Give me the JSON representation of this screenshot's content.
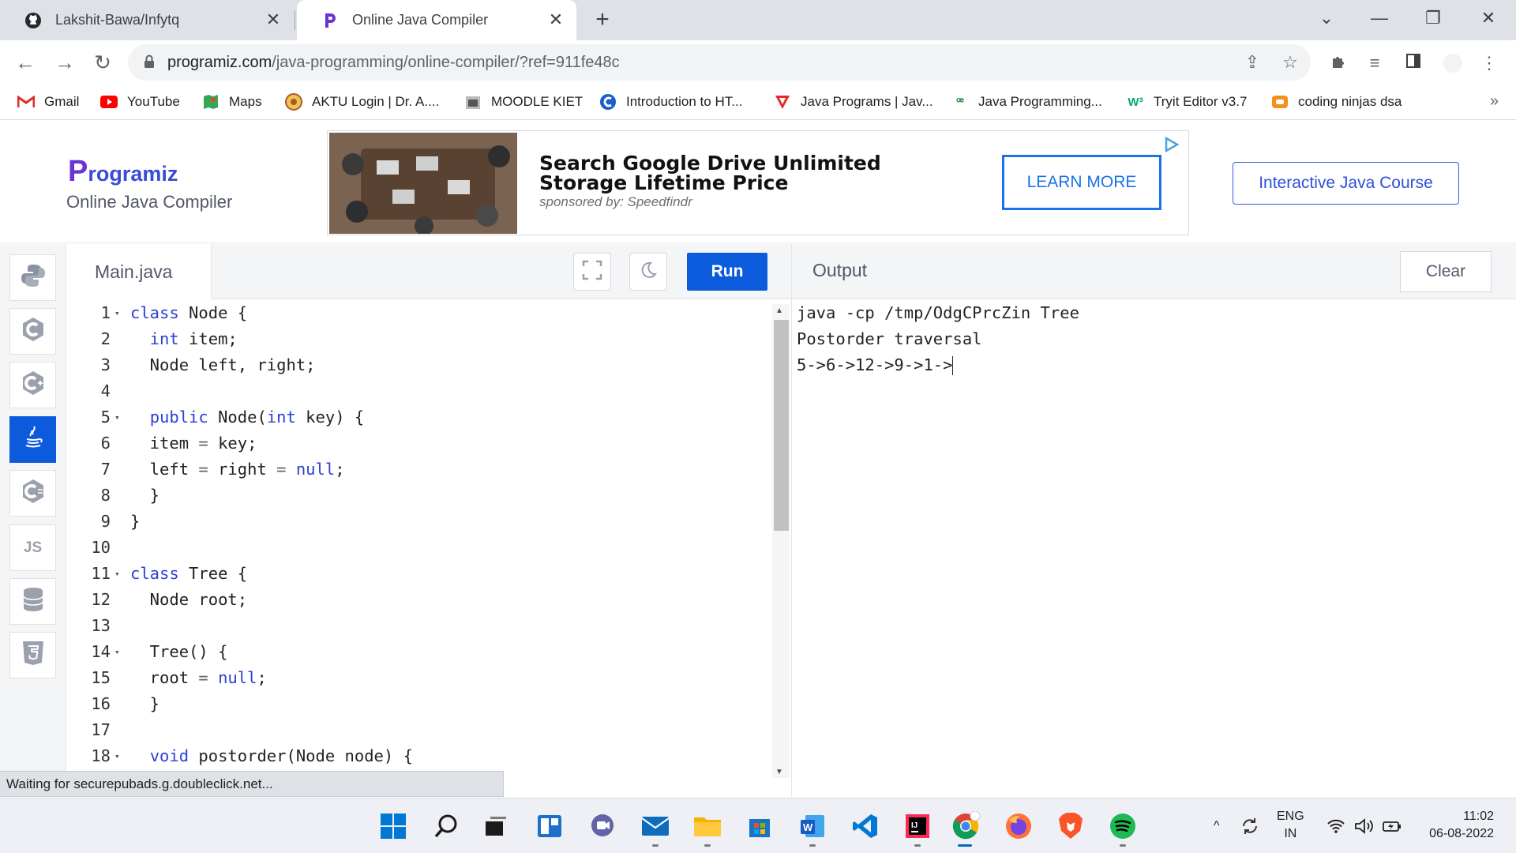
{
  "browser": {
    "tabs": [
      {
        "title": "Lakshit-Bawa/Infytq",
        "icon": "github-icon"
      },
      {
        "title": "Online Java Compiler",
        "icon": "programiz-icon"
      }
    ],
    "url_host": "programiz.com",
    "url_path": "/java-programming/online-compiler/?ref=911fe48c",
    "bookmarks": [
      {
        "label": "Gmail",
        "icon": "gmail-icon"
      },
      {
        "label": "YouTube",
        "icon": "youtube-icon"
      },
      {
        "label": "Maps",
        "icon": "maps-icon"
      },
      {
        "label": "AKTU Login | Dr. A....",
        "icon": "aktu-icon"
      },
      {
        "label": "MOODLE KIET",
        "icon": "moodle-icon"
      },
      {
        "label": "Introduction to HT...",
        "icon": "intro-icon"
      },
      {
        "label": "Java Programs | Jav...",
        "icon": "javatpoint-icon"
      },
      {
        "label": "Java Programming...",
        "icon": "gfg-icon"
      },
      {
        "label": "Tryit Editor v3.7",
        "icon": "w3schools-icon"
      },
      {
        "label": "coding ninjas dsa",
        "icon": "codingninjas-icon"
      }
    ],
    "more_bookmarks": "»"
  },
  "header": {
    "logo_p": "P",
    "logo_rest": "rogramiz",
    "subtitle": "Online Java Compiler",
    "course_button": "Interactive Java Course"
  },
  "ad": {
    "title": "Search Google Drive Unlimited Storage Lifetime Price",
    "sponsor": "sponsored by: Speedfindr",
    "cta": "LEARN MORE"
  },
  "rail": {
    "languages": [
      "python",
      "c",
      "cpp",
      "java",
      "csharp",
      "js",
      "sql",
      "html"
    ],
    "active": "java",
    "js_label": "JS"
  },
  "editor": {
    "filename": "Main.java",
    "run_label": "Run",
    "lines": [
      {
        "n": "1",
        "fold": true,
        "code": "class Node {"
      },
      {
        "n": "2",
        "fold": false,
        "code": "  int item;"
      },
      {
        "n": "3",
        "fold": false,
        "code": "  Node left, right;"
      },
      {
        "n": "4",
        "fold": false,
        "code": ""
      },
      {
        "n": "5",
        "fold": true,
        "code": "  public Node(int key) {"
      },
      {
        "n": "6",
        "fold": false,
        "code": "  item = key;"
      },
      {
        "n": "7",
        "fold": false,
        "code": "  left = right = null;"
      },
      {
        "n": "8",
        "fold": false,
        "code": "  }"
      },
      {
        "n": "9",
        "fold": false,
        "code": "}"
      },
      {
        "n": "10",
        "fold": false,
        "code": ""
      },
      {
        "n": "11",
        "fold": true,
        "code": "class Tree {"
      },
      {
        "n": "12",
        "fold": false,
        "code": "  Node root;"
      },
      {
        "n": "13",
        "fold": false,
        "code": ""
      },
      {
        "n": "14",
        "fold": true,
        "code": "  Tree() {"
      },
      {
        "n": "15",
        "fold": false,
        "code": "  root = null;"
      },
      {
        "n": "16",
        "fold": false,
        "code": "  }"
      },
      {
        "n": "17",
        "fold": false,
        "code": ""
      },
      {
        "n": "18",
        "fold": true,
        "code": "  void postorder(Node node) {"
      }
    ]
  },
  "output": {
    "title": "Output",
    "clear_label": "Clear",
    "lines": [
      "java -cp /tmp/OdgCPrcZin Tree",
      "Postorder traversal",
      "5->6->12->9->1->"
    ]
  },
  "status": "Waiting for securepubads.g.doubleclick.net...",
  "taskbar": {
    "apps": [
      "windows-start",
      "search",
      "task-view",
      "widgets",
      "teams-chat",
      "mail",
      "file-explorer",
      "microsoft-store",
      "word",
      "vscode",
      "intellij",
      "chrome",
      "firefox",
      "brave",
      "spotify"
    ],
    "lang_top": "ENG",
    "lang_bottom": "IN",
    "time": "11:02",
    "date": "06-08-2022"
  },
  "colors": {
    "accent": "#0d5bdd",
    "keyword": "#2b3fd6",
    "logo_purple": "#6b33d6"
  }
}
